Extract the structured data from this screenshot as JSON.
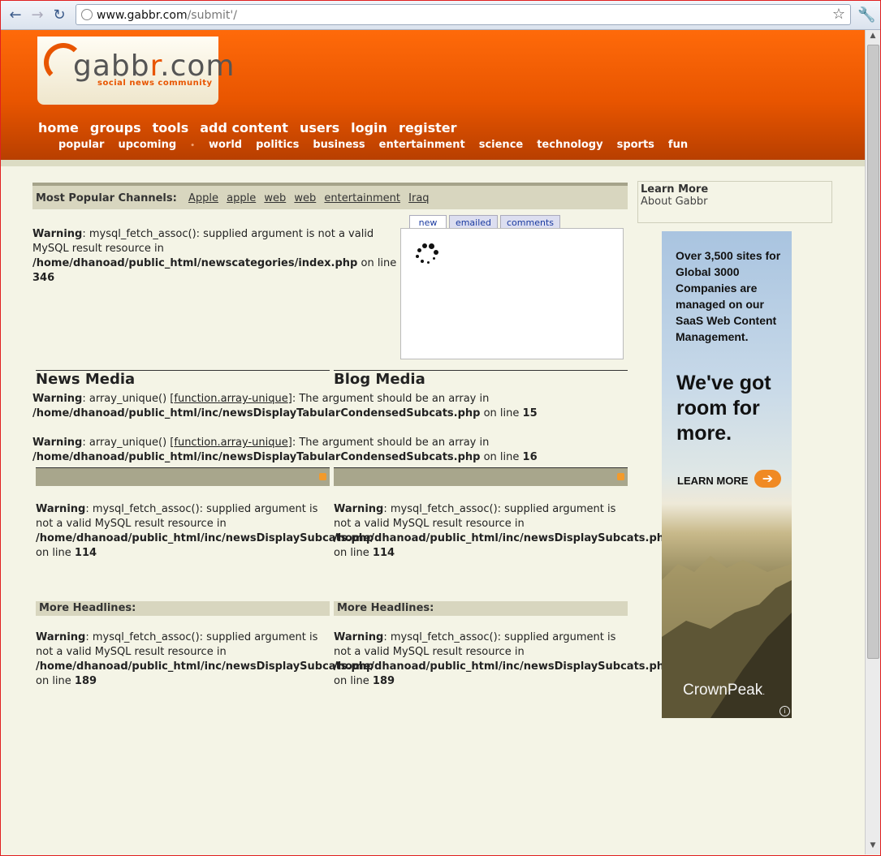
{
  "browser": {
    "url_host": "www.gabbr.com",
    "url_path": "/submit'/"
  },
  "logo": {
    "name_gray": "gabb",
    "name_orange": "r",
    "name_rest": ".com",
    "tagline": "social news community"
  },
  "main_nav": [
    "home",
    "groups",
    "tools",
    "add content",
    "users",
    "login",
    "register"
  ],
  "sub_nav": [
    "popular",
    "upcoming",
    "world",
    "politics",
    "business",
    "entertainment",
    "science",
    "technology",
    "sports",
    "fun"
  ],
  "channels": {
    "label": "Most Popular Channels:",
    "links": [
      "Apple",
      "apple",
      "web",
      "web",
      "entertainment",
      "Iraq"
    ]
  },
  "warning1": {
    "label": "Warning",
    "text": ": mysql_fetch_assoc(): supplied argument is not a valid MySQL result resource in",
    "path": "/home/dhanoad/public_html/newscategories/index.php",
    "on_line": " on line ",
    "line": "346"
  },
  "tabs": [
    "new",
    "emailed",
    "comments"
  ],
  "columns": {
    "left_title": "News Media",
    "right_title": "Blog Media"
  },
  "array_warnings": [
    {
      "label": "Warning",
      "pre": ": array_unique() [",
      "link": "function.array-unique",
      "post": "]: The argument should be an array in",
      "path": "/home/dhanoad/public_html/inc/newsDisplayTabularCondensedSubcats.php",
      "on_line": " on line ",
      "line": "15"
    },
    {
      "label": "Warning",
      "pre": ": array_unique() [",
      "link": "function.array-unique",
      "post": "]: The argument should be an array in",
      "path": "/home/dhanoad/public_html/inc/newsDisplayTabularCondensedSubcats.php",
      "on_line": " on line ",
      "line": "16"
    }
  ],
  "fetch_warnings": {
    "label": "Warning",
    "text": ": mysql_fetch_assoc(): supplied argument is not a valid MySQL result resource in",
    "path": "/home/dhanoad/public_html/inc/newsDisplaySubcats.php",
    "on_line": "on line ",
    "line_a": "114",
    "line_b": "189"
  },
  "more_headlines": "More Headlines:",
  "sidebar": {
    "title": "Learn More",
    "link": "About Gabbr"
  },
  "ad": {
    "headline": "Over 3,500 sites for Global 3000 Companies are managed on our SaaS Web Content Management.",
    "big": "We've got room for more.",
    "cta": "LEARN MORE",
    "brand": "CrownPeak",
    "brand_mark": ".",
    "arrow": "➔",
    "info": "i"
  }
}
